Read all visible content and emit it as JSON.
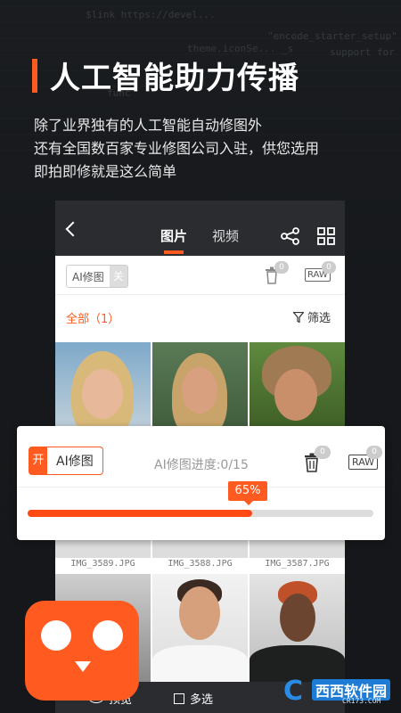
{
  "headline": "人工智能助力传播",
  "description": [
    "除了业界独有的人工智能自动修图外",
    "还有全国数百家专业修图公司入驻，供您选用",
    "即拍即修就是这么简单"
  ],
  "background_code": [
    "$link https://devel...",
    "theme.iconSe... _s",
    "\"encode_starter_setup\"",
    "func",
    "support for"
  ],
  "phone": {
    "tabs": {
      "images": "图片",
      "video": "视频"
    },
    "toolbar": {
      "ai_label": "AI修图",
      "ai_state": "关",
      "trash_count": "0",
      "raw_label": "RAW",
      "raw_count": "0"
    },
    "filter": {
      "all_label": "全部（1）",
      "filter_label": "筛选"
    },
    "photos": [
      "",
      "",
      "",
      "IMG_3589.JPG",
      "IMG_3588.JPG",
      "IMG_3587.JPG",
      "",
      "",
      ""
    ],
    "bottom": {
      "preview": "预览",
      "multi_select": "多选"
    }
  },
  "progress_card": {
    "ai_state": "开",
    "ai_label": "AI修图",
    "progress_text": "AI修图进度:0/15",
    "trash_count": "0",
    "raw_label": "RAW",
    "raw_count": "0",
    "percent_label": "65%",
    "progress": 0.65
  },
  "logo": {
    "mark": "C",
    "text": "西西软件园",
    "sub": "CR173.COM"
  },
  "colors": {
    "accent": "#ff5a1f",
    "dark": "#2a2c30"
  }
}
